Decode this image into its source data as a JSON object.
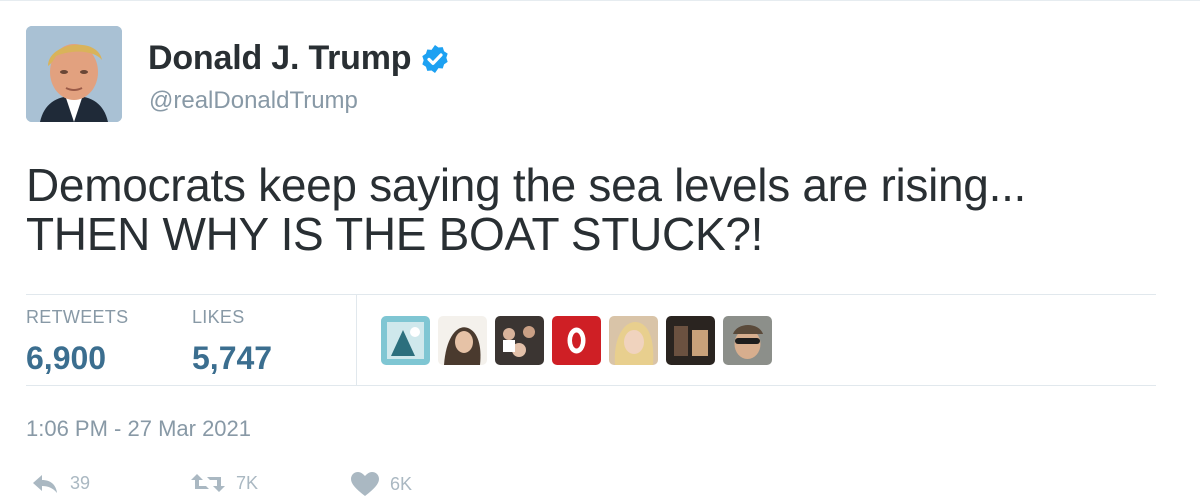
{
  "author": {
    "name": "Donald J. Trump",
    "handle": "@realDonaldTrump",
    "verified_icon": "verified-badge-icon",
    "avatar_icon": "profile-photo"
  },
  "tweet": {
    "lines": [
      "Democrats keep saying the sea levels are rising...",
      "THEN WHY IS THE BOAT STUCK?!"
    ]
  },
  "stats": {
    "retweets_label": "RETWEETS",
    "retweets_value": "6,900",
    "likes_label": "LIKES",
    "likes_value": "5,747"
  },
  "likers": [
    "liker-avatar-1",
    "liker-avatar-2",
    "liker-avatar-3",
    "liker-avatar-4",
    "liker-avatar-5",
    "liker-avatar-6",
    "liker-avatar-7"
  ],
  "timestamp": "1:06 PM - 27 Mar 2021",
  "actions": {
    "reply_icon": "reply-icon",
    "reply_count": "39",
    "retweet_icon": "retweet-icon",
    "retweet_count": "7K",
    "like_icon": "heart-icon",
    "like_count": "6K"
  },
  "colors": {
    "text": "#292f33",
    "muted": "#8899a6",
    "stat_value": "#3b6e8f",
    "verified": "#1da1f2",
    "divider": "#e1e8ed"
  }
}
